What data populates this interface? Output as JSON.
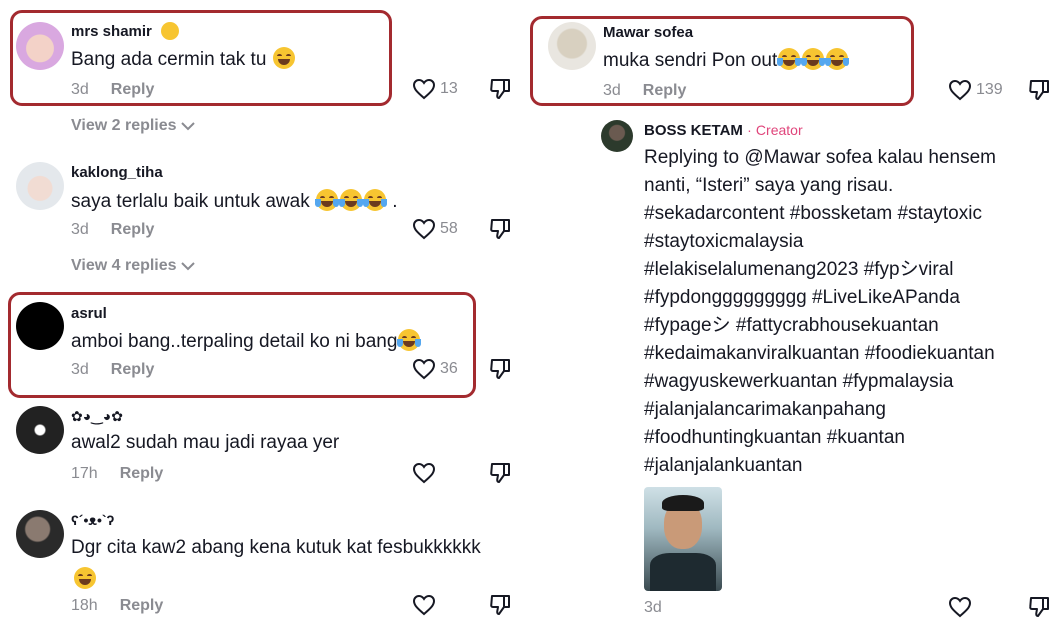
{
  "comments": [
    {
      "username": "mrs shamir",
      "text": "Bang ada cermin tak tu",
      "time": "3d",
      "reply": "Reply",
      "likes": "13"
    },
    {
      "username": "kaklong_tiha",
      "text": "saya terlalu baik untuk awak",
      "text_suffix": ".",
      "time": "3d",
      "reply": "Reply",
      "likes": "58"
    },
    {
      "username": "asrul",
      "text": "amboi bang..terpaling detail ko ni bang",
      "time": "3d",
      "reply": "Reply",
      "likes": "36"
    },
    {
      "username": "✿◕‿◕✿",
      "text": "awal2 sudah mau jadi rayaa yer",
      "time": "17h",
      "reply": "Reply",
      "likes": ""
    },
    {
      "username": "ʕ´•ᴥ•`ʔ",
      "text": "Dgr cita kaw2 abang kena kutuk kat fesbukkkkkk",
      "time": "18h",
      "reply": "Reply",
      "likes": ""
    }
  ],
  "view_replies": [
    "View 2 replies",
    "View 4 replies"
  ],
  "right_comment": {
    "username": "Mawar sofea",
    "text": "muka sendri Pon out",
    "time": "3d",
    "reply": "Reply",
    "likes": "139"
  },
  "creator_reply": {
    "username": "BOSS KETAM",
    "separator": "·",
    "badge": "Creator",
    "lines": [
      "Replying to @Mawar sofea kalau hensem",
      "nanti, “Isteri” saya yang risau.",
      "#sekadarcontent #bossketam #staytoxic",
      "#staytoxicmalaysia",
      "#lelakiselalumenang2023 #fypシviral",
      "#fypdonggggggggg #LiveLikeAPanda",
      "#fypageシ #fattycrabhousekuantan",
      "#kedaimakanviralkuantan #foodiekuantan",
      "#wagyuskewerkuantan #fypmalaysia",
      "#jalanjalancarimakanpahang",
      "#foodhuntingkuantan #kuantan",
      "#jalanjalankuantan"
    ],
    "time": "3d"
  },
  "colors": {
    "highlight": "#a32a2f",
    "muted": "#8a8b91",
    "creator": "#e0457b"
  },
  "icons": [
    "heart-icon",
    "dislike-icon",
    "chevron-down-icon",
    "emoji-icon"
  ]
}
